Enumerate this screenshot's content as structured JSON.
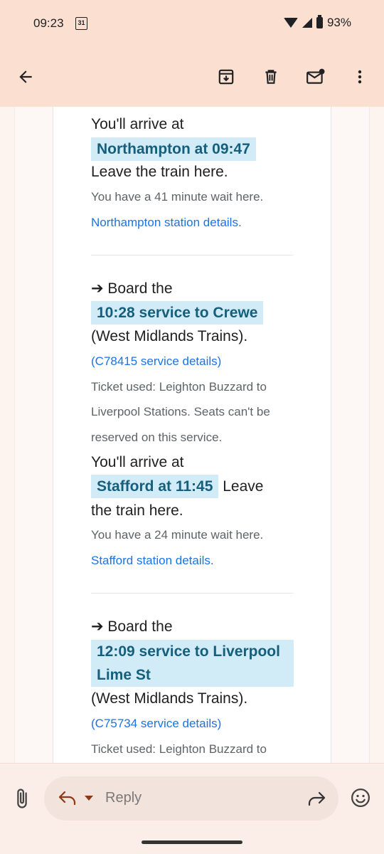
{
  "status": {
    "time": "09:23",
    "calendar_day": "31",
    "battery": "93%"
  },
  "appbar": {
    "icons": [
      "back-arrow-icon",
      "archive-icon",
      "delete-icon",
      "mark-unread-icon",
      "more-vert-icon"
    ]
  },
  "email": {
    "seg1": {
      "arrive_intro": "You'll arrive at",
      "arrive_station": "Northampton at 09:47",
      "leave": "Leave the train here.",
      "wait": "You have a 41 minute wait here.",
      "station_link": "Northampton station details",
      "station_link_suffix": "."
    },
    "seg2": {
      "board_prefix": "➔ Board the",
      "service": "10:28 service to Crewe",
      "operator": "(West Midlands Trains).",
      "service_link": "(C78415 service details)",
      "ticket_line1": "Ticket used: Leighton Buzzard to",
      "ticket_line2": "Liverpool Stations. Seats can't be",
      "ticket_line3": "reserved on this service.",
      "arrive_intro": "You'll arrive at",
      "arrive_station": "Stafford at 11:45",
      "leave_part1": "Leave",
      "leave_part2": "the train here.",
      "wait": "You have a 24 minute wait here.",
      "station_link": "Stafford station details",
      "station_link_suffix": "."
    },
    "seg3": {
      "board_prefix": "➔ Board the",
      "service_line1": "12:09 service to Liverpool",
      "service_line2": "Lime St",
      "operator": "(West Midlands Trains).",
      "service_link": "(C75734 service details)",
      "ticket_line1": "Ticket used: Leighton Buzzard to"
    }
  },
  "reply": {
    "placeholder": "Reply"
  },
  "colors": {
    "highlight_bg": "#d2ecf7",
    "highlight_text": "#155f7c",
    "link": "#1a73e8",
    "header_bg": "#fbe0d2"
  }
}
